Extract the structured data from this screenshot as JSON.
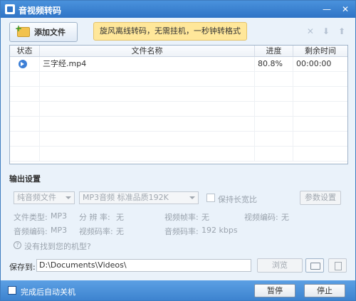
{
  "window": {
    "title": "音视频转码"
  },
  "toolbar": {
    "add_file": "添加文件",
    "banner": "旋风离线转码，无需挂机，一秒钟转格式"
  },
  "table": {
    "headers": {
      "status": "状态",
      "filename": "文件名称",
      "progress": "进度",
      "remaining": "剩余时间"
    },
    "rows": [
      {
        "filename": "三字经.mp4",
        "progress": "80.8%",
        "remaining": "00:00:00"
      }
    ]
  },
  "output": {
    "title": "输出设置",
    "format_select": "纯音频文件",
    "quality_select": "MP3音频 标准品质192K",
    "keep_ratio": "保持长宽比",
    "params_button": "参数设置",
    "file_type_label": "文件类型:",
    "file_type_value": "MP3",
    "resolution_label": "分 辨 率:",
    "resolution_value": "无",
    "frame_rate_label": "视频帧率:",
    "frame_rate_value": "无",
    "video_codec_label": "视频编码:",
    "video_codec_value": "无",
    "audio_codec_label": "音频编码:",
    "audio_codec_value": "MP3",
    "video_bitrate_label": "视频码率:",
    "video_bitrate_value": "无",
    "audio_bitrate_label": "音频码率:",
    "audio_bitrate_value": "192 kbps",
    "help_link": "没有找到您的机型?"
  },
  "save": {
    "label": "保存到:",
    "path": "D:\\Documents\\Videos\\",
    "browse": "浏览"
  },
  "bottom": {
    "auto_shutdown": "完成后自动关机",
    "pause": "暂停",
    "stop": "停止"
  }
}
